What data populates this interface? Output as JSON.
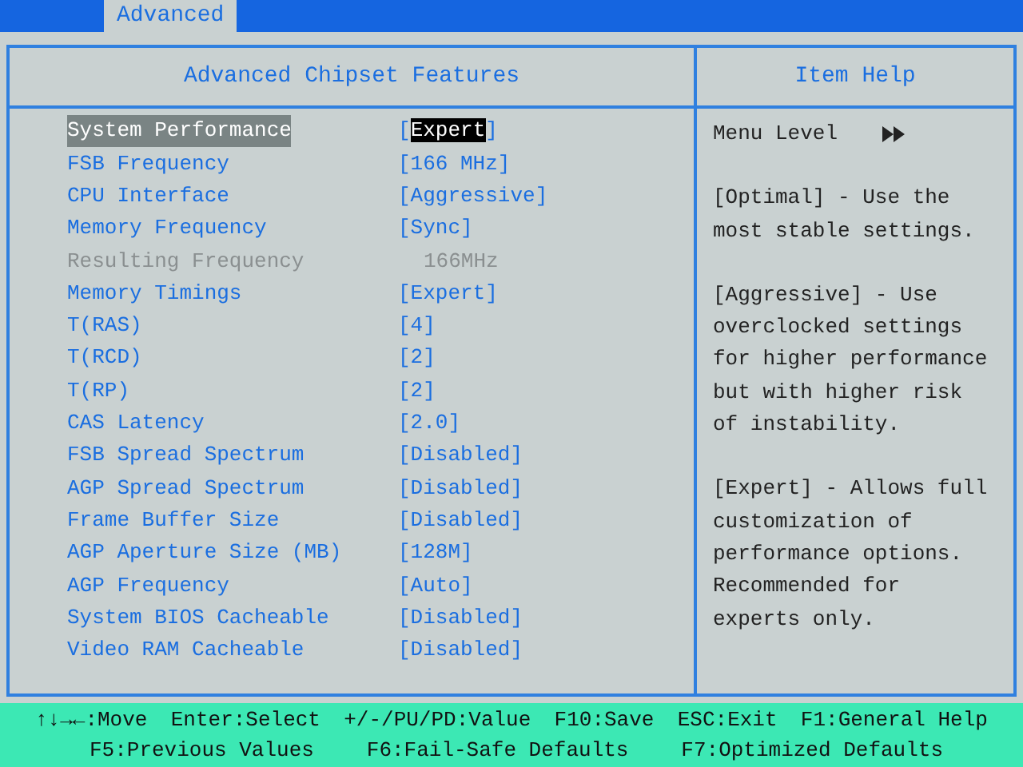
{
  "tabs": [
    {
      "label": "Advanced",
      "selected": true
    }
  ],
  "panel": {
    "title": "Advanced Chipset Features",
    "help_title": "Item Help"
  },
  "items": [
    {
      "label": "System Performance",
      "value": "[Expert]",
      "kind": "option",
      "selected": true
    },
    {
      "label": "FSB Frequency",
      "value": "[166 MHz]",
      "kind": "option",
      "selected": false
    },
    {
      "label": "CPU Interface",
      "value": "[Aggressive]",
      "kind": "option",
      "selected": false
    },
    {
      "label": "Memory Frequency",
      "value": "[Sync]",
      "kind": "option",
      "selected": false
    },
    {
      "label": "Resulting Frequency",
      "value": "166MHz",
      "kind": "readonly",
      "selected": false
    },
    {
      "label": "Memory Timings",
      "value": "[Expert]",
      "kind": "option",
      "selected": false
    },
    {
      "label": "T(RAS)",
      "value": "[4]",
      "kind": "option",
      "selected": false
    },
    {
      "label": "T(RCD)",
      "value": "[2]",
      "kind": "option",
      "selected": false
    },
    {
      "label": "T(RP)",
      "value": "[2]",
      "kind": "option",
      "selected": false
    },
    {
      "label": "CAS Latency",
      "value": "[2.0]",
      "kind": "option",
      "selected": false
    },
    {
      "label": "FSB Spread Spectrum",
      "value": "[Disabled]",
      "kind": "option",
      "selected": false
    },
    {
      "label": "AGP Spread Spectrum",
      "value": "[Disabled]",
      "kind": "option",
      "selected": false
    },
    {
      "label": "Frame Buffer Size",
      "value": "[Disabled]",
      "kind": "option",
      "selected": false
    },
    {
      "label": "AGP Aperture Size (MB)",
      "value": "[128M]",
      "kind": "option",
      "selected": false
    },
    {
      "label": "AGP Frequency",
      "value": "[Auto]",
      "kind": "option",
      "selected": false
    },
    {
      "label": "System BIOS Cacheable",
      "value": "[Disabled]",
      "kind": "option",
      "selected": false
    },
    {
      "label": "Video RAM Cacheable",
      "value": "[Disabled]",
      "kind": "option",
      "selected": false
    }
  ],
  "help": {
    "menu_level": "Menu Level",
    "paragraphs": [
      "[Optimal] - Use the most stable settings.",
      "[Aggressive] - Use overclocked settings for higher performance but with higher risk of instability.",
      "[Expert] - Allows full customization of performance options. Recommended for experts only."
    ]
  },
  "footer": [
    [
      "↑↓→←:Move",
      "Enter:Select",
      "+/-/PU/PD:Value",
      "F10:Save",
      "ESC:Exit",
      "F1:General Help"
    ],
    [
      "F5:Previous Values",
      "F6:Fail-Safe Defaults",
      "F7:Optimized Defaults"
    ]
  ]
}
